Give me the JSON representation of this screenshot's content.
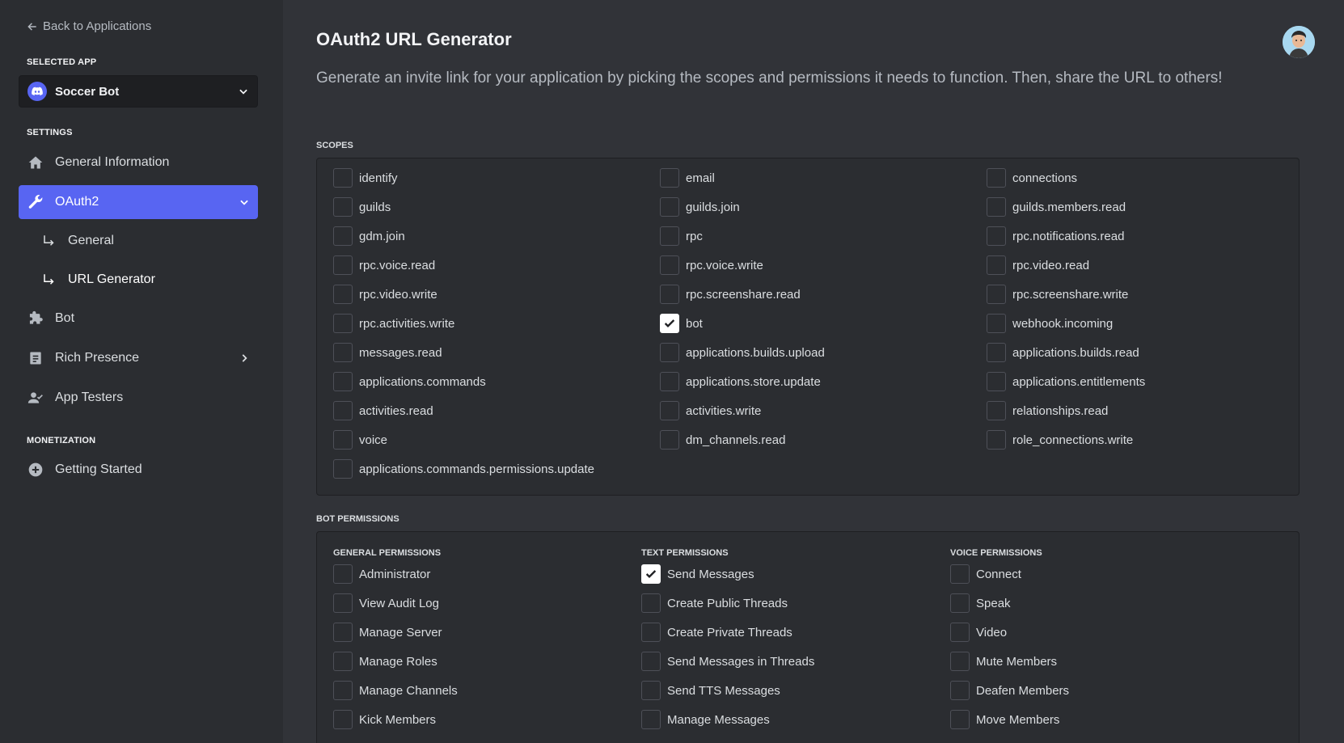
{
  "sidebar": {
    "back_label": "Back to Applications",
    "selected_app_label": "SELECTED APP",
    "app_name": "Soccer Bot",
    "settings_label": "SETTINGS",
    "items": {
      "general_info": "General Information",
      "oauth2": "OAuth2",
      "oauth2_general": "General",
      "url_generator": "URL Generator",
      "bot": "Bot",
      "rich_presence": "Rich Presence",
      "app_testers": "App Testers"
    },
    "monetization_label": "MONETIZATION",
    "getting_started": "Getting Started",
    "accent_color": "#5865f2"
  },
  "main": {
    "title": "OAuth2 URL Generator",
    "description": "Generate an invite link for your application by picking the scopes and permissions it needs to function. Then, share the URL to others!",
    "scopes_label": "SCOPES",
    "scopes": [
      {
        "label": "identify",
        "checked": false
      },
      {
        "label": "email",
        "checked": false
      },
      {
        "label": "connections",
        "checked": false
      },
      {
        "label": "guilds",
        "checked": false
      },
      {
        "label": "guilds.join",
        "checked": false
      },
      {
        "label": "guilds.members.read",
        "checked": false
      },
      {
        "label": "gdm.join",
        "checked": false
      },
      {
        "label": "rpc",
        "checked": false
      },
      {
        "label": "rpc.notifications.read",
        "checked": false
      },
      {
        "label": "rpc.voice.read",
        "checked": false
      },
      {
        "label": "rpc.voice.write",
        "checked": false
      },
      {
        "label": "rpc.video.read",
        "checked": false
      },
      {
        "label": "rpc.video.write",
        "checked": false
      },
      {
        "label": "rpc.screenshare.read",
        "checked": false
      },
      {
        "label": "rpc.screenshare.write",
        "checked": false
      },
      {
        "label": "rpc.activities.write",
        "checked": false
      },
      {
        "label": "bot",
        "checked": true
      },
      {
        "label": "webhook.incoming",
        "checked": false
      },
      {
        "label": "messages.read",
        "checked": false
      },
      {
        "label": "applications.builds.upload",
        "checked": false
      },
      {
        "label": "applications.builds.read",
        "checked": false
      },
      {
        "label": "applications.commands",
        "checked": false
      },
      {
        "label": "applications.store.update",
        "checked": false
      },
      {
        "label": "applications.entitlements",
        "checked": false
      },
      {
        "label": "activities.read",
        "checked": false
      },
      {
        "label": "activities.write",
        "checked": false
      },
      {
        "label": "relationships.read",
        "checked": false
      },
      {
        "label": "voice",
        "checked": false
      },
      {
        "label": "dm_channels.read",
        "checked": false
      },
      {
        "label": "role_connections.write",
        "checked": false
      },
      {
        "label": "applications.commands.permissions.update",
        "checked": false
      }
    ],
    "bot_permissions_label": "BOT PERMISSIONS",
    "permission_groups": [
      {
        "title": "GENERAL PERMISSIONS",
        "items": [
          {
            "label": "Administrator",
            "checked": false
          },
          {
            "label": "View Audit Log",
            "checked": false
          },
          {
            "label": "Manage Server",
            "checked": false
          },
          {
            "label": "Manage Roles",
            "checked": false
          },
          {
            "label": "Manage Channels",
            "checked": false
          },
          {
            "label": "Kick Members",
            "checked": false
          }
        ]
      },
      {
        "title": "TEXT PERMISSIONS",
        "items": [
          {
            "label": "Send Messages",
            "checked": true
          },
          {
            "label": "Create Public Threads",
            "checked": false
          },
          {
            "label": "Create Private Threads",
            "checked": false
          },
          {
            "label": "Send Messages in Threads",
            "checked": false
          },
          {
            "label": "Send TTS Messages",
            "checked": false
          },
          {
            "label": "Manage Messages",
            "checked": false
          }
        ]
      },
      {
        "title": "VOICE PERMISSIONS",
        "items": [
          {
            "label": "Connect",
            "checked": false
          },
          {
            "label": "Speak",
            "checked": false
          },
          {
            "label": "Video",
            "checked": false
          },
          {
            "label": "Mute Members",
            "checked": false
          },
          {
            "label": "Deafen Members",
            "checked": false
          },
          {
            "label": "Move Members",
            "checked": false
          }
        ]
      }
    ]
  }
}
